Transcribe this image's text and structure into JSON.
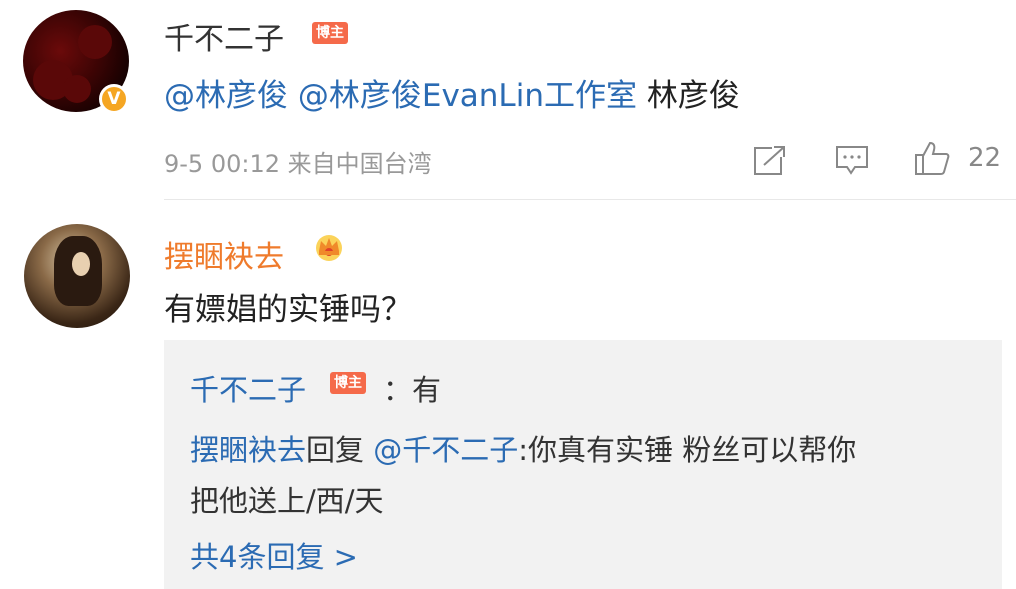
{
  "comment": {
    "author": "千不二子",
    "author_badge": "博主",
    "content_mentions": [
      "@林彦俊",
      "@林彦俊EvanLin工作室"
    ],
    "content_tail": "林彦俊",
    "timestamp": "9-5 00:12",
    "source": "来自中国台湾",
    "like_count": "22",
    "icons": {
      "share": "share-icon",
      "comment": "comment-icon",
      "like": "thumbs-up-icon",
      "verified": "verified-v-icon"
    }
  },
  "reply": {
    "author": "摆睏袂去",
    "content": "有嫖娼的实锤吗？",
    "icons": {
      "crown": "crown-icon"
    },
    "sub_replies": [
      {
        "author": "千不二子",
        "badge": "博主",
        "text": "：有"
      },
      {
        "author": "摆睏袂去",
        "action": "回复",
        "mention": "@千不二子",
        "text_line1": ":你真有实锤 粉丝可以帮你",
        "text_line2": "把他送上/西/天"
      }
    ],
    "more_link": "共4条回复 >"
  },
  "colors": {
    "mention": "#2b6bb3",
    "reply_author": "#ef7b2c",
    "badge": "#f56a4a",
    "verified": "#f5a623"
  }
}
